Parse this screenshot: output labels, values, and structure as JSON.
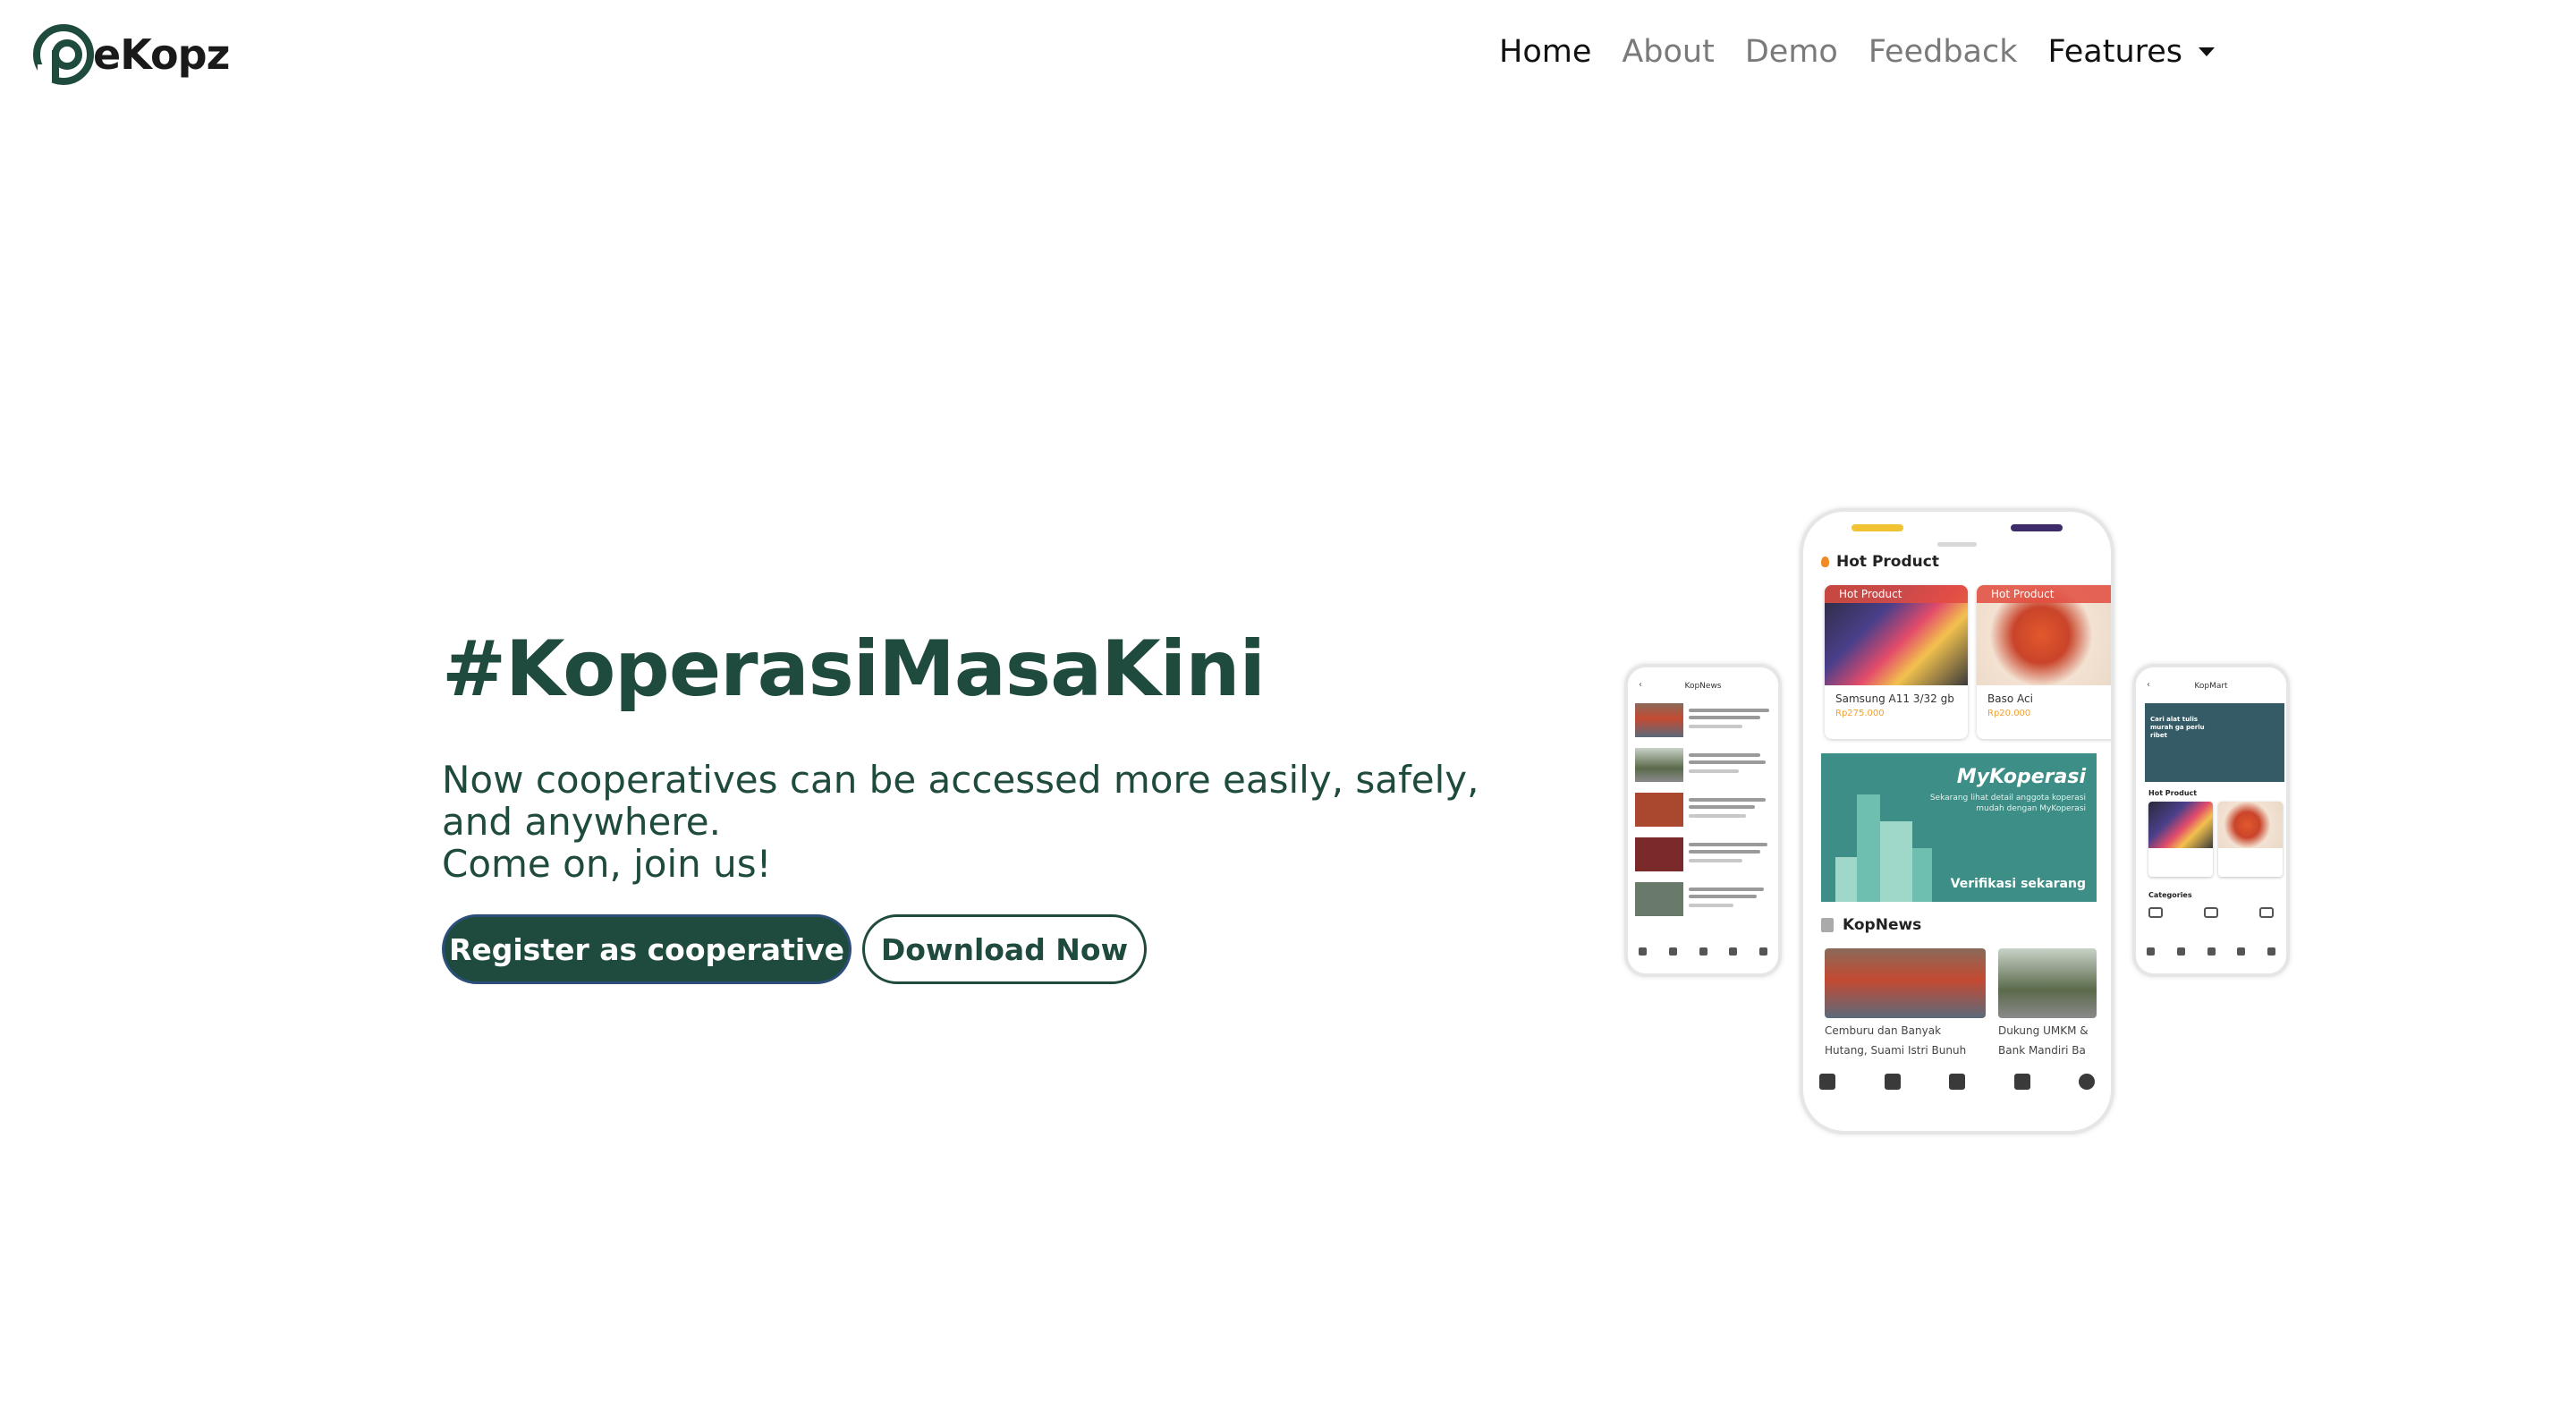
{
  "brand": {
    "name": "eKopz",
    "logo_letter_color": "#1f4a3e"
  },
  "nav": {
    "items": [
      {
        "label": "Home",
        "active": true
      },
      {
        "label": "About",
        "active": false
      },
      {
        "label": "Demo",
        "active": false
      },
      {
        "label": "Feedback",
        "active": false
      }
    ],
    "features_label": "Features"
  },
  "hero": {
    "title": "#KoperasiMasaKini",
    "subtitle_line1": "Now cooperatives can be accessed more easily, safely,",
    "subtitle_line2": "and anywhere.",
    "subtitle_line3": "Come on, join us!",
    "primary_button": "Register as cooperative",
    "secondary_button": "Download Now",
    "accent_color": "#1f4a3e"
  },
  "phone_main": {
    "hot_product_heading": "Hot Product",
    "products": [
      {
        "tag": "Hot Product",
        "name": "Samsung A11 3/32 gb",
        "price": "Rp275.000"
      },
      {
        "tag": "Hot Product",
        "name": "Baso Aci",
        "price": "Rp20.000"
      }
    ],
    "banner": {
      "title": "MyKoperasi",
      "text": "Sekarang lihat detail anggota koperasi mudah dengan MyKoperasi",
      "cta": "Verifikasi sekarang"
    },
    "news_heading": "KopNews",
    "news": [
      {
        "line1": "Cemburu dan Banyak",
        "line2": "Hutang, Suami Istri Bunuh"
      },
      {
        "line1": "Dukung UMKM &",
        "line2": "Bank Mandiri Ba"
      }
    ]
  },
  "phone_left": {
    "heading": "KopNews"
  },
  "phone_right": {
    "heading": "KopMart",
    "banner_text": "Cari alat tulis murah ga perlu ribet",
    "hot_label": "Hot Product",
    "categories_label": "Categories"
  }
}
